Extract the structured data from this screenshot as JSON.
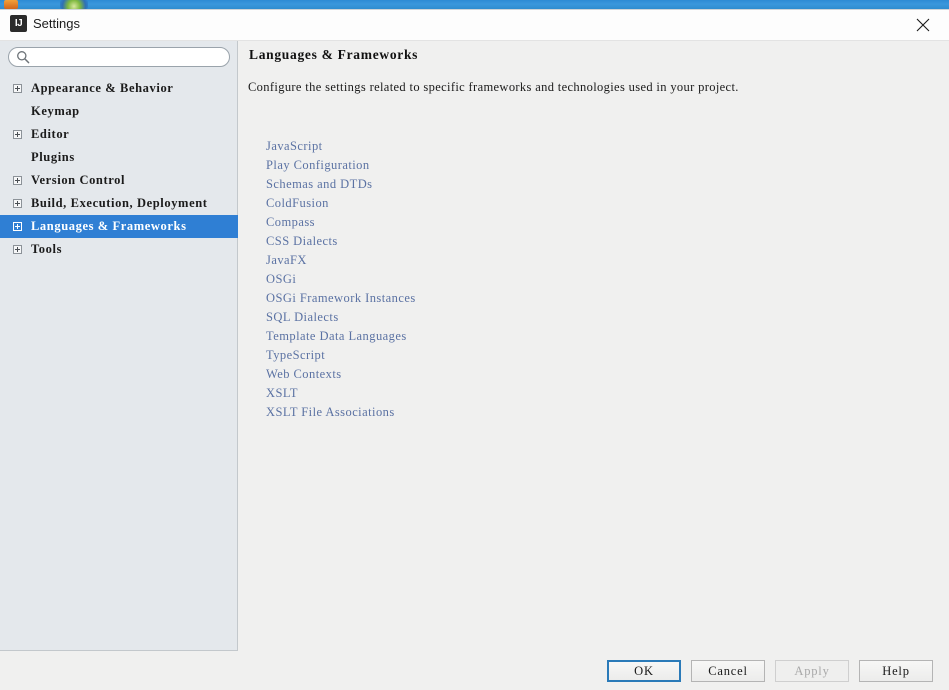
{
  "window": {
    "title": "Settings",
    "app_icon": "IJ",
    "app_icon_name": "intellij-idea-icon",
    "close_icon": "close-icon"
  },
  "search": {
    "value": "",
    "placeholder": "",
    "icon": "search-icon"
  },
  "sidebar": {
    "items": [
      {
        "label": "Appearance & Behavior",
        "expandable": true,
        "selected": false
      },
      {
        "label": "Keymap",
        "expandable": false,
        "selected": false
      },
      {
        "label": "Editor",
        "expandable": true,
        "selected": false
      },
      {
        "label": "Plugins",
        "expandable": false,
        "selected": false
      },
      {
        "label": "Version Control",
        "expandable": true,
        "selected": false
      },
      {
        "label": "Build, Execution, Deployment",
        "expandable": true,
        "selected": false
      },
      {
        "label": "Languages & Frameworks",
        "expandable": true,
        "selected": true
      },
      {
        "label": "Tools",
        "expandable": true,
        "selected": false
      }
    ],
    "selection_color": "#2f7fd4",
    "background_color": "#e4e8ec"
  },
  "content": {
    "title": "Languages & Frameworks",
    "description": "Configure the settings related to specific frameworks and technologies used in your project.",
    "link_color": "#5b72a3",
    "links": [
      "JavaScript",
      "Play Configuration",
      "Schemas and DTDs",
      "ColdFusion",
      "Compass",
      "CSS Dialects",
      "JavaFX",
      "OSGi",
      "OSGi Framework Instances",
      "SQL Dialects",
      "Template Data Languages",
      "TypeScript",
      "Web Contexts",
      "XSLT",
      "XSLT File Associations"
    ]
  },
  "footer": {
    "buttons": [
      {
        "label": "OK",
        "state": "default"
      },
      {
        "label": "Cancel",
        "state": "normal"
      },
      {
        "label": "Apply",
        "state": "disabled"
      },
      {
        "label": "Help",
        "state": "normal"
      }
    ],
    "default_border_color": "#2a7ab8"
  }
}
